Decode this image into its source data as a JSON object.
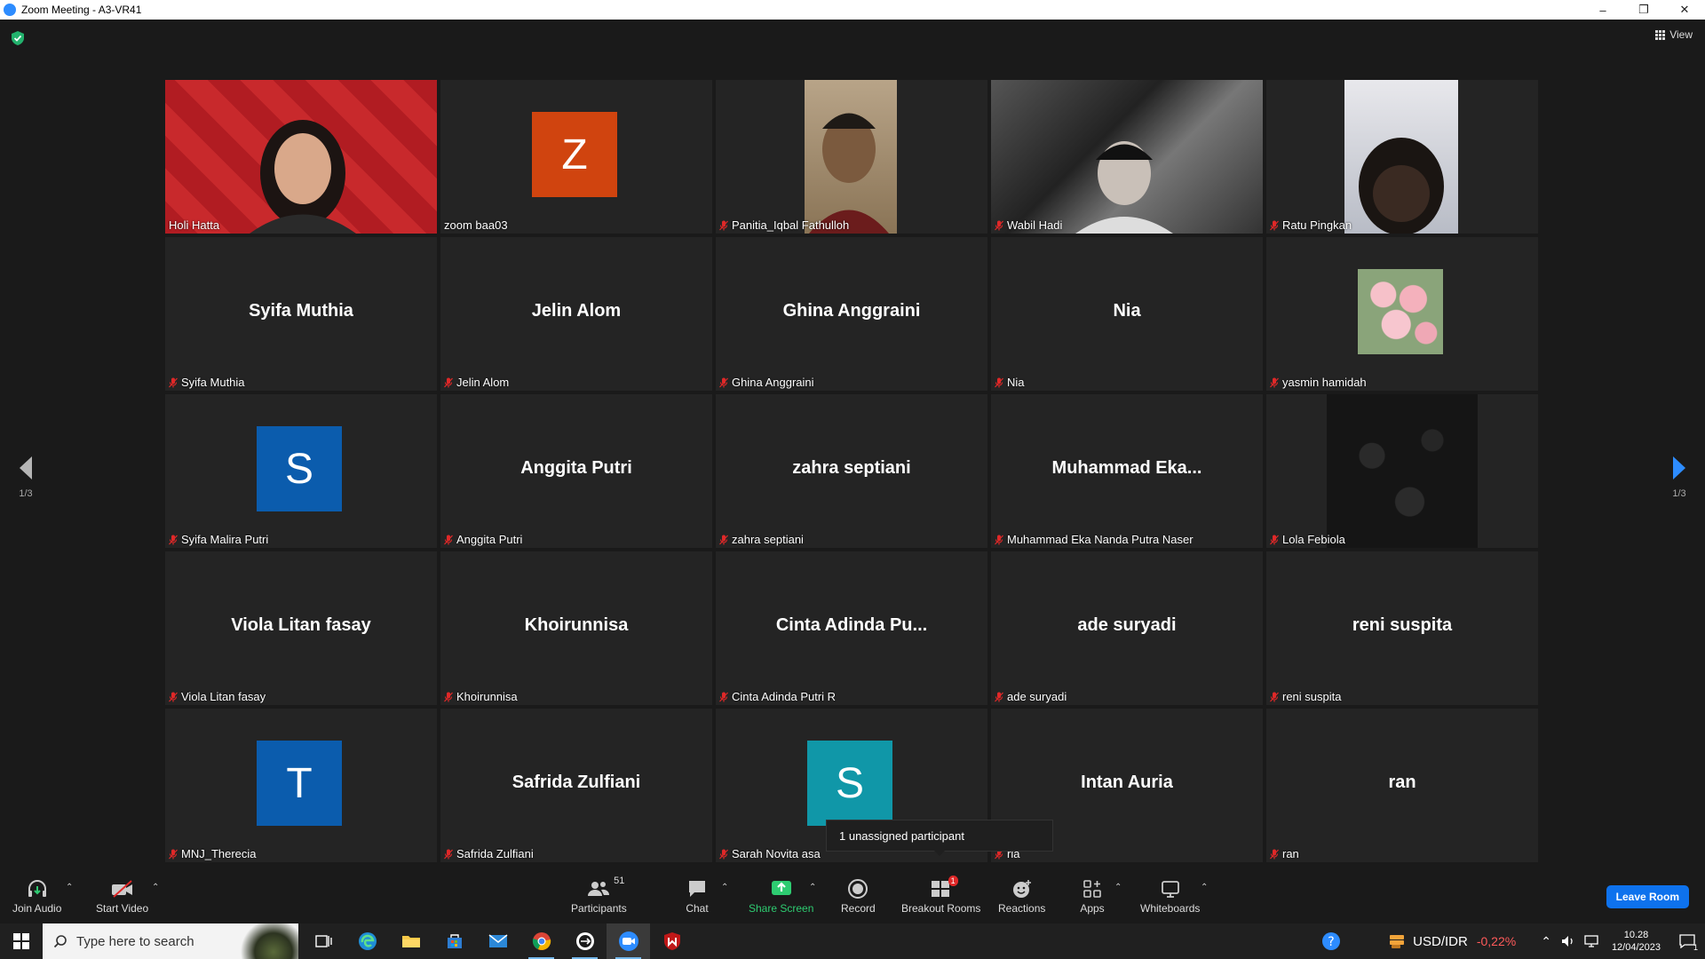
{
  "window": {
    "title": "Zoom Meeting - A3-VR41"
  },
  "header": {
    "view_label": "View"
  },
  "pager": {
    "left": "1/3",
    "right": "1/3"
  },
  "tiles": [
    {
      "big": "",
      "caption": "Holi Hatta",
      "muted": false,
      "active": true,
      "kind": "video-holi"
    },
    {
      "big": "",
      "caption": "zoom baa03",
      "muted": false,
      "kind": "avatar",
      "letter": "Z",
      "color": "#d0440f"
    },
    {
      "big": "",
      "caption": "Panitia_Iqbal Fathulloh",
      "muted": true,
      "kind": "video-iqbal"
    },
    {
      "big": "",
      "caption": "Wabil Hadi",
      "muted": true,
      "kind": "video-wabil"
    },
    {
      "big": "",
      "caption": "Ratu Pingkan",
      "muted": true,
      "kind": "video-ratu"
    },
    {
      "big": "Syifa Muthia",
      "caption": "Syifa Muthia",
      "muted": true
    },
    {
      "big": "Jelin Alom",
      "caption": "Jelin Alom",
      "muted": true
    },
    {
      "big": "Ghina Anggraini",
      "caption": "Ghina Anggraini",
      "muted": true
    },
    {
      "big": "Nia",
      "caption": "Nia",
      "muted": true
    },
    {
      "big": "",
      "caption": "yasmin hamidah",
      "muted": true,
      "kind": "roses"
    },
    {
      "big": "",
      "caption": "Syifa Malira Putri",
      "muted": true,
      "kind": "avatar",
      "letter": "S",
      "color": "#0b5cad"
    },
    {
      "big": "Anggita Putri",
      "caption": "Anggita Putri",
      "muted": true
    },
    {
      "big": "zahra septiani",
      "caption": "zahra septiani",
      "muted": true
    },
    {
      "big": "Muhammad  Eka...",
      "caption": "Muhammad Eka Nanda Putra Naser",
      "muted": true
    },
    {
      "big": "",
      "caption": "Lola Febiola",
      "muted": true,
      "kind": "dark-pattern"
    },
    {
      "big": "Viola Litan fasay",
      "caption": "Viola Litan fasay",
      "muted": true
    },
    {
      "big": "Khoirunnisa",
      "caption": "Khoirunnisa",
      "muted": true
    },
    {
      "big": "Cinta Adinda Pu...",
      "caption": "Cinta Adinda Putri R",
      "muted": true
    },
    {
      "big": "ade suryadi",
      "caption": "ade suryadi",
      "muted": true
    },
    {
      "big": "reni suspita",
      "caption": "reni suspita",
      "muted": true
    },
    {
      "big": "",
      "caption": "MNJ_Therecia",
      "muted": true,
      "kind": "avatar",
      "letter": "T",
      "color": "#0b5cad"
    },
    {
      "big": "Safrida Zulfiani",
      "caption": "Safrida Zulfiani",
      "muted": true
    },
    {
      "big": "",
      "caption": "Sarah Novita asa",
      "muted": true,
      "kind": "avatar",
      "letter": "S",
      "color": "#1097a8"
    },
    {
      "big": "Intan Auria",
      "caption": "ria",
      "muted": true
    },
    {
      "big": "ran",
      "caption": "ran",
      "muted": true
    }
  ],
  "tooltip": {
    "text": "1 unassigned participant"
  },
  "toolbar": {
    "join_audio": "Join Audio",
    "start_video": "Start Video",
    "participants": "Participants",
    "participants_count": "51",
    "chat": "Chat",
    "share_screen": "Share Screen",
    "record": "Record",
    "breakout_rooms": "Breakout Rooms",
    "breakout_badge": "1",
    "reactions": "Reactions",
    "apps": "Apps",
    "whiteboards": "Whiteboards",
    "leave": "Leave Room"
  },
  "taskbar": {
    "search_placeholder": "Type here to search",
    "currency": "USD/IDR",
    "change": "-0,22%",
    "time": "10.28",
    "date": "12/04/2023",
    "notif_count": "1"
  },
  "colors": {
    "accent": "#0e72ed",
    "active_border": "#f5e84a",
    "share_green": "#2ecc71",
    "muted_red": "#e02828"
  }
}
